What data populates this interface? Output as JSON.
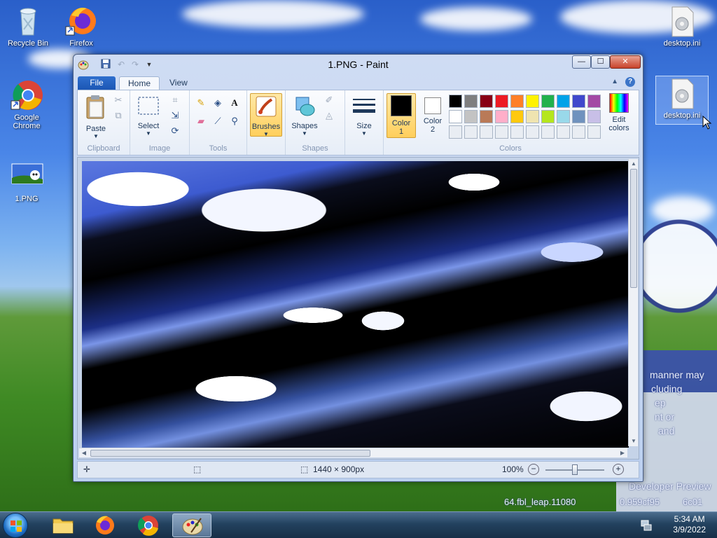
{
  "desktop": {
    "icons": [
      {
        "label": "Recycle Bin"
      },
      {
        "label": "Firefox"
      },
      {
        "label": "Google Chrome"
      },
      {
        "label": "1.PNG"
      },
      {
        "label": "desktop.ini"
      },
      {
        "label": "desktop.ini"
      }
    ],
    "wallpaper_text": [
      "manner may",
      "cluding",
      "ep",
      "nt or",
      "and",
      "Developer Preview",
      "64.fbl_leap.11080",
      "0.959cf95",
      "6c01"
    ]
  },
  "window": {
    "title": "1.PNG - Paint",
    "qat": {
      "save_icon": "save-icon",
      "undo_icon": "undo-icon",
      "redo_icon": "redo-icon",
      "customize_icon": "dropdown-icon"
    },
    "controls": {
      "minimize": "—",
      "maximize": "☐",
      "close": "✕"
    },
    "tabs": {
      "file": "File",
      "home": "Home",
      "view": "View"
    },
    "ribbon": {
      "clipboard": {
        "paste": "Paste",
        "label": "Clipboard"
      },
      "image": {
        "select": "Select",
        "label": "Image"
      },
      "tools": {
        "label": "Tools"
      },
      "brushes": {
        "label": "Brushes"
      },
      "shapes": {
        "shapes": "Shapes",
        "label": "Shapes"
      },
      "size": {
        "label": "Size"
      },
      "colors": {
        "color1": "Color",
        "color1_num": "1",
        "color2": "Color",
        "color2_num": "2",
        "edit": "Edit",
        "edit2": "colors",
        "label": "Colors",
        "color1_value": "#000000",
        "color2_value": "#ffffff",
        "row1": [
          "#000000",
          "#7f7f7f",
          "#880015",
          "#ed1c24",
          "#ff7f27",
          "#fff200",
          "#22b14c",
          "#00a2e8",
          "#3f48cc",
          "#a349a4"
        ],
        "row2": [
          "#ffffff",
          "#c3c3c3",
          "#b97a57",
          "#ffaec9",
          "#ffc90e",
          "#efe4b0",
          "#b5e61d",
          "#99d9ea",
          "#7092be",
          "#c8bfe7"
        ],
        "row3": [
          "#e9edf3",
          "#e9edf3",
          "#e9edf3",
          "#e9edf3",
          "#e9edf3",
          "#e9edf3",
          "#e9edf3",
          "#e9edf3",
          "#e9edf3",
          "#e9edf3"
        ]
      }
    },
    "status": {
      "dimensions": "1440 × 900px",
      "zoom": "100%"
    }
  },
  "taskbar": {
    "clock_time": "5:34 AM",
    "clock_date": "3/9/2022"
  }
}
